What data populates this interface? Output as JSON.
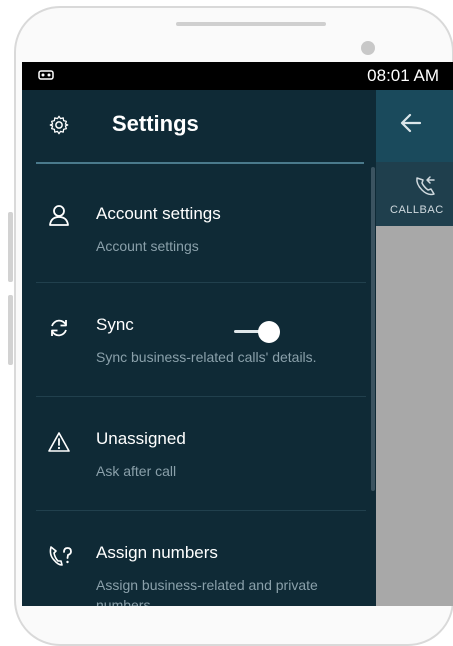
{
  "status_bar": {
    "time": "08:01 AM",
    "left_icon": "cassette-icon"
  },
  "drawer": {
    "title": "Settings",
    "items": [
      {
        "label": "Account settings",
        "description": "Account settings",
        "icon": "person-icon"
      },
      {
        "label": "Sync",
        "description": "Sync business-related calls' details.",
        "icon": "sync-icon",
        "toggle_on": true
      },
      {
        "label": "Unassigned",
        "description": "Ask after call",
        "icon": "warning-icon"
      },
      {
        "label": "Assign numbers",
        "description": "Assign business-related and private numbers",
        "icon": "phone-question-icon"
      }
    ]
  },
  "app": {
    "tab_label": "CALLBAC"
  },
  "colors": {
    "drawer_bg": "#0f2a36",
    "accent": "#4a7a8c",
    "header_bg": "#1a4a5c"
  }
}
